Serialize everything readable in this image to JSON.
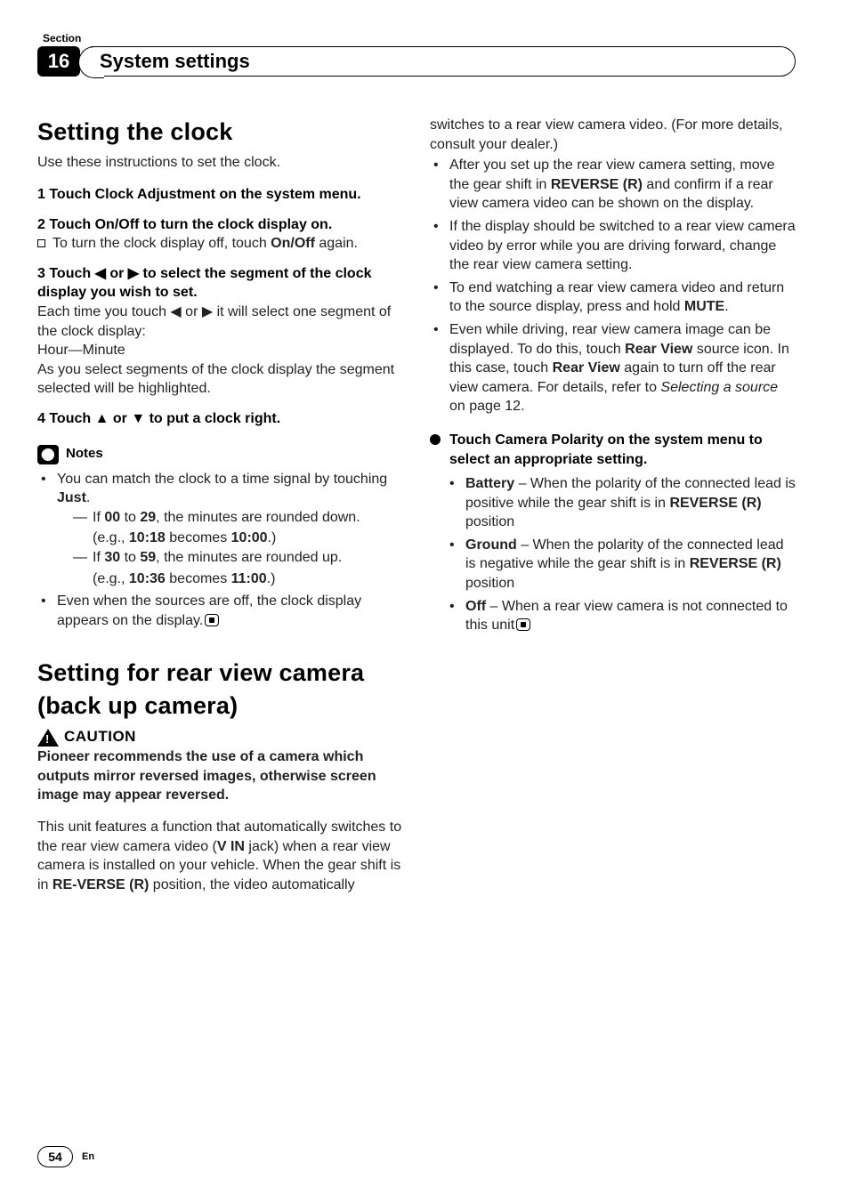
{
  "header": {
    "section_label": "Section",
    "section_number": "16",
    "chapter_title": "System settings"
  },
  "left": {
    "h_clock": "Setting the clock",
    "intro": "Use these instructions to set the clock.",
    "step1": "1    Touch Clock Adjustment on the system menu.",
    "step2": "2    Touch On/Off to turn the clock display on.",
    "step2_body_a": "To turn the clock display off, touch ",
    "step2_body_b": "On/Off",
    "step2_body_c": " again.",
    "step3": "3    Touch ◀ or ▶ to select the segment of the clock display you wish to set.",
    "step3_body1": "Each time you touch ◀ or ▶ it will select one segment of the clock display:",
    "step3_body2": "Hour—Minute",
    "step3_body3": "As you select segments of the clock display the segment selected will be highlighted.",
    "step4": "4    Touch ▲ or ▼ to put a clock right.",
    "notes_label": "Notes",
    "note1_a": "You can match the clock to a time signal by touching ",
    "note1_b": "Just",
    "note1_c": ".",
    "note1_s1_a": "If ",
    "note1_s1_b": "00",
    "note1_s1_c": " to ",
    "note1_s1_d": "29",
    "note1_s1_e": ", the minutes are rounded down.",
    "note1_s1_eg_a": "(e.g., ",
    "note1_s1_eg_b": "10:18",
    "note1_s1_eg_c": " becomes ",
    "note1_s1_eg_d": "10:00",
    "note1_s1_eg_e": ".)",
    "note1_s2_a": "If ",
    "note1_s2_b": "30",
    "note1_s2_c": " to ",
    "note1_s2_d": "59",
    "note1_s2_e": ", the minutes are rounded up.",
    "note1_s2_eg_a": "(e.g., ",
    "note1_s2_eg_b": "10:36",
    "note1_s2_eg_c": " becomes ",
    "note1_s2_eg_d": "11:00",
    "note1_s2_eg_e": ".)",
    "note2": "Even when the sources are off, the clock display appears on the display.",
    "h_cam": "Setting for rear view camera (back up camera)",
    "caution_label": "CAUTION",
    "caution_body": "Pioneer recommends the use of a camera which outputs mirror reversed images, otherwise screen image may appear reversed.",
    "cam_p1_a": "This unit features a function that automatically switches to the rear view camera video (",
    "cam_p1_b": "V IN",
    "cam_p1_c": " jack) when a rear view camera is installed on your vehicle. When the gear shift is in ",
    "cam_p1_d": "RE-VERSE (R)",
    "cam_p1_e": " position, the video automatically"
  },
  "right": {
    "cont1": "switches to a rear view camera video. (For more details, consult your dealer.)",
    "b1_a": "After you set up the rear view camera setting, move the gear shift in ",
    "b1_b": "REVERSE (R)",
    "b1_c": " and confirm if a rear view camera video can be shown on the display.",
    "b2": "If the display should be switched to a rear view camera video by error while you are driving forward, change the rear view camera setting.",
    "b3_a": "To end watching a rear view camera video and return to the source display, press and hold ",
    "b3_b": "MUTE",
    "b3_c": ".",
    "b4_a": "Even while driving, rear view camera image can be displayed. To do this, touch ",
    "b4_b": "Rear View",
    "b4_c": " source icon. In this case, touch ",
    "b4_d": "Rear View",
    "b4_e": " again to turn off the rear view camera. For details, refer to ",
    "b4_f": "Selecting a source",
    "b4_g": " on page 12.",
    "lead": "Touch Camera Polarity on the system menu to select an appropriate setting.",
    "p1_a": "Battery",
    "p1_b": " – When the polarity of the connected lead is positive while the gear shift is in ",
    "p1_c": "REVERSE (R)",
    "p1_d": " position",
    "p2_a": "Ground",
    "p2_b": " – When the polarity of the connected lead is negative while the gear shift is in ",
    "p2_c": "REVERSE (R)",
    "p2_d": " position",
    "p3_a": "Off",
    "p3_b": " – When a rear view camera is not connected to this unit"
  },
  "footer": {
    "page": "54",
    "lang": "En"
  }
}
